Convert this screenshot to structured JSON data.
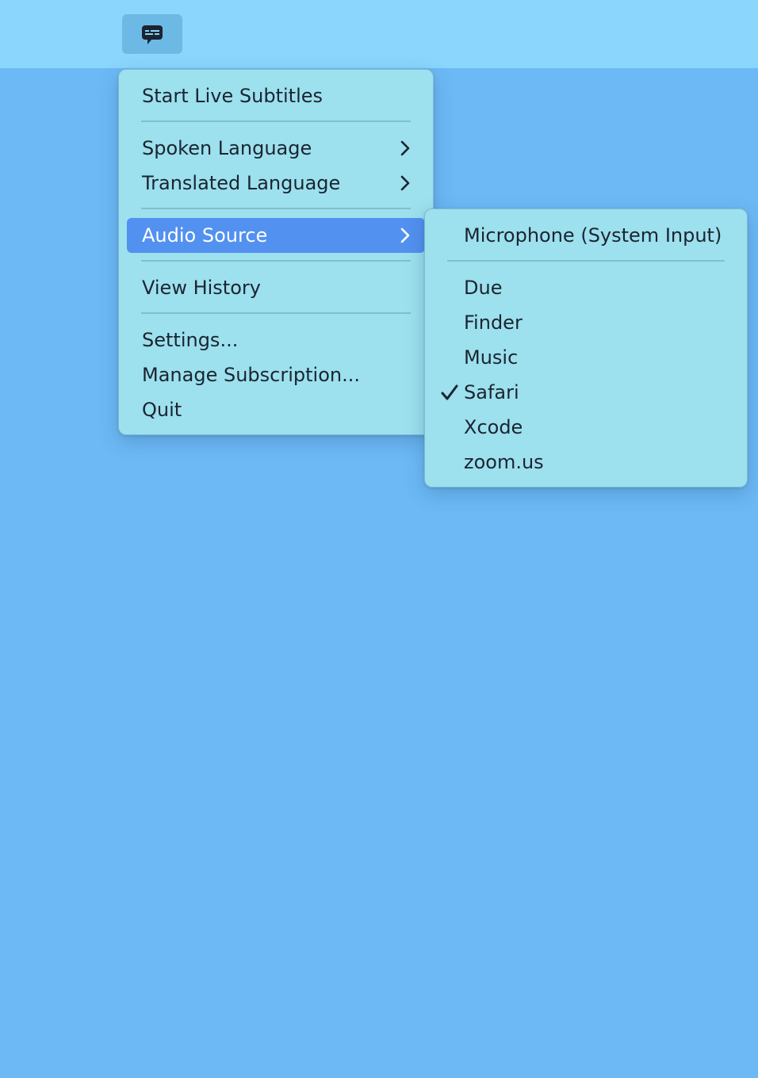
{
  "colors": {
    "desktop": "#6cb9f6",
    "menubar": "#8ad6fc",
    "menu_background": "#9de0ee",
    "highlight": "#5291f0"
  },
  "status_item": {
    "icon": "subtitles-bubble-icon"
  },
  "main_menu": {
    "start_live_subtitles": "Start Live Subtitles",
    "spoken_language": "Spoken Language",
    "translated_language": "Translated Language",
    "audio_source": "Audio Source",
    "view_history": "View History",
    "settings": "Settings...",
    "manage_subscription": "Manage Subscription...",
    "quit": "Quit"
  },
  "audio_source_menu": {
    "microphone": "Microphone (System Input)",
    "apps": [
      "Due",
      "Finder",
      "Music",
      "Safari",
      "Xcode",
      "zoom.us"
    ],
    "selected": "Safari"
  }
}
